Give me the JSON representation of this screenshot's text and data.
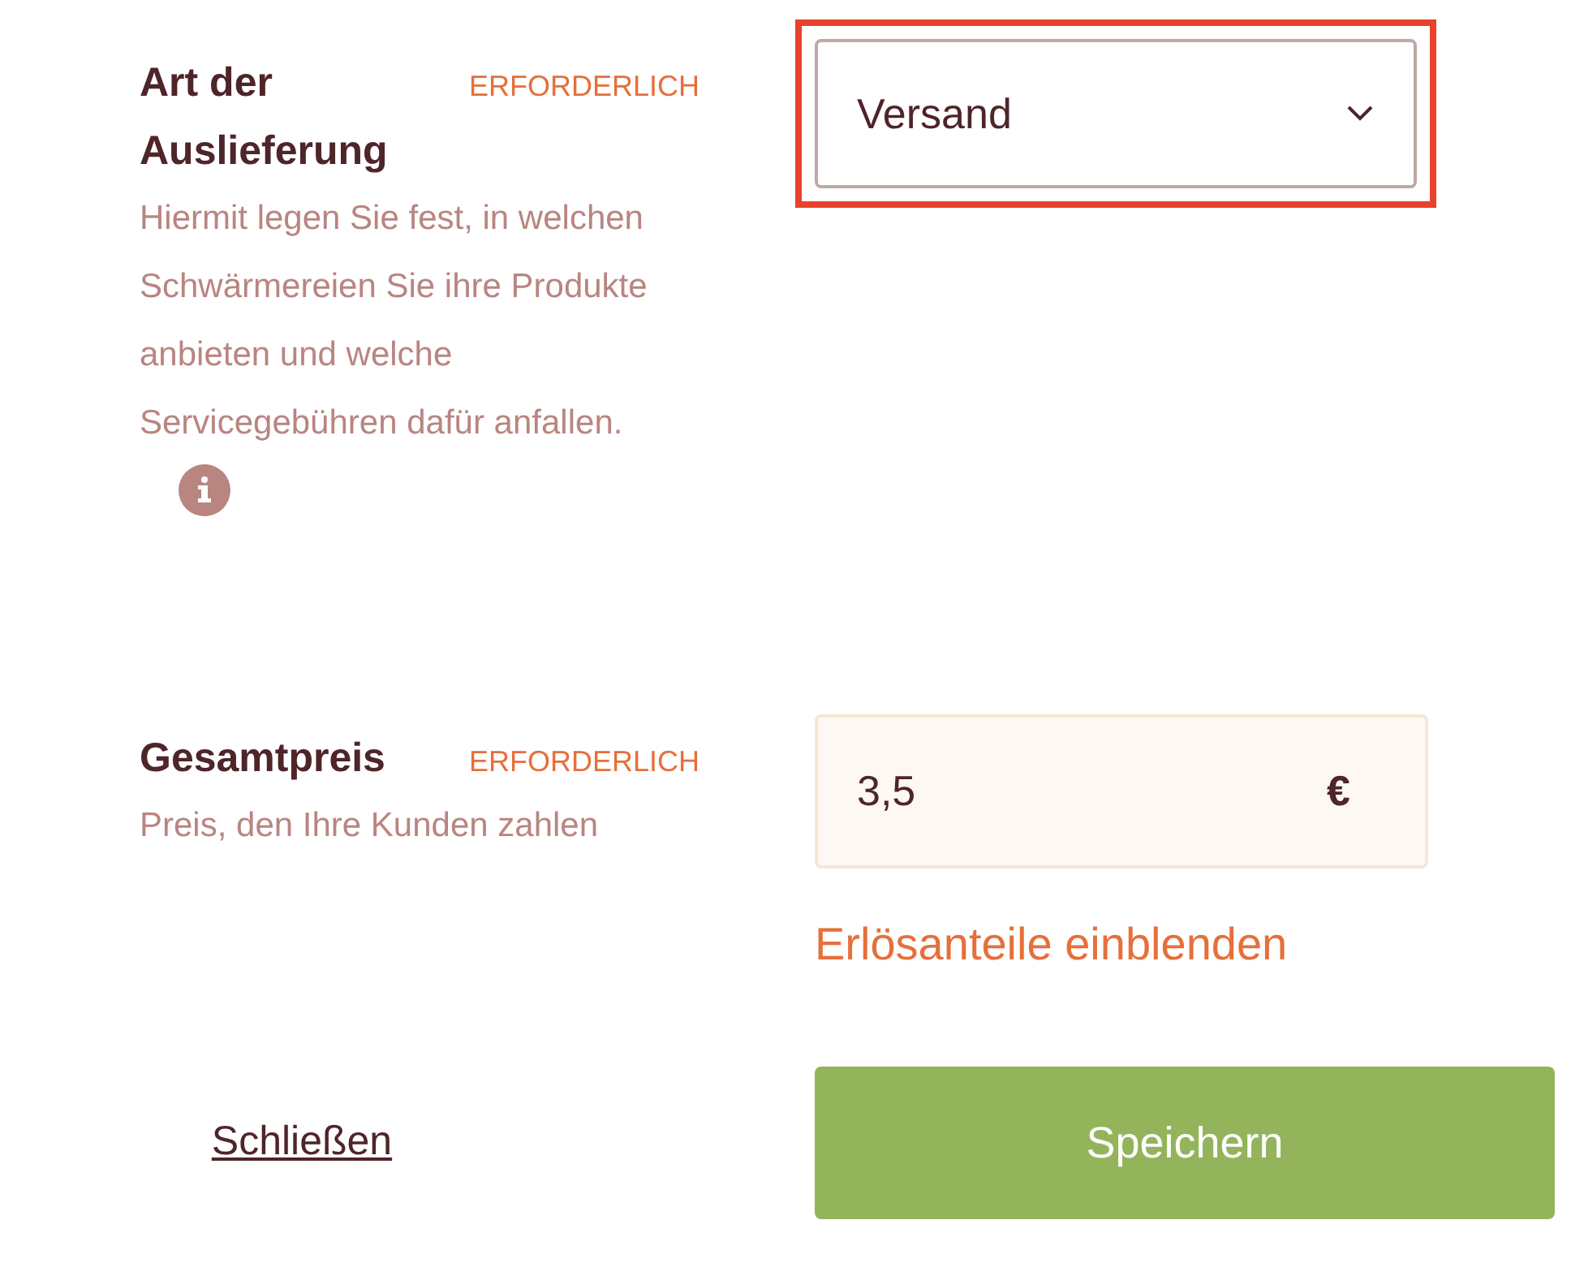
{
  "fields": [
    {
      "kind": "select",
      "label": "Art der Auslieferung",
      "badge": "ERFORDERLICH",
      "description": "Hiermit legen Sie fest, in welchen Schwärmereien Sie ihre Produkte anbieten und welche Servicegebühren dafür anfallen.",
      "info": true,
      "value": "Versand",
      "highlighted": true
    },
    {
      "kind": "price",
      "label": "Gesamtpreis",
      "badge": "ERFORDERLICH",
      "description": "Preis, den Ihre Kunden zahlen",
      "info": false,
      "value": "3,5",
      "unit": "€",
      "link": "Erlösanteile einblenden"
    }
  ],
  "actions": {
    "close": "Schließen",
    "save": "Speichern"
  }
}
